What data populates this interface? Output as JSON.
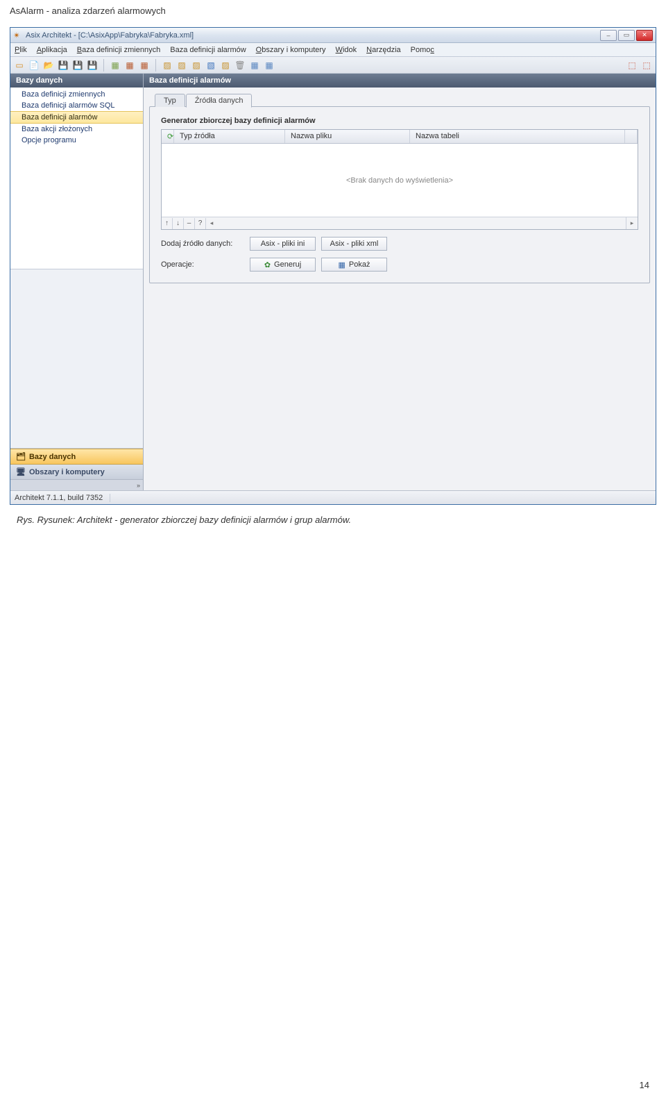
{
  "doc_header": "AsAlarm - analiza zdarzeń alarmowych",
  "title": "Asix Architekt - [C:\\AsixApp\\Fabryka\\Fabryka.xml]",
  "menu": {
    "items": [
      {
        "label": "Plik",
        "u": "P"
      },
      {
        "label": "Aplikacja",
        "u": "A"
      },
      {
        "label": "Baza definicji zmiennych",
        "u": "B"
      },
      {
        "label": "Baza definicji alarmów"
      },
      {
        "label": "Obszary i komputery",
        "u": "O"
      },
      {
        "label": "Widok",
        "u": "W"
      },
      {
        "label": "Narzędzia",
        "u": "N"
      },
      {
        "label": "Pomoc",
        "u": "c"
      }
    ]
  },
  "sidebar": {
    "header": "Bazy danych",
    "items": [
      "Baza definicji zmiennych",
      "Baza definicji alarmów SQL",
      "Baza definicji alarmów",
      "Baza akcji złożonych",
      "Opcje programu"
    ],
    "selected_index": 2,
    "tabs": {
      "active": "Bazy danych",
      "inactive": "Obszary i komputery",
      "footer_arrow": "»"
    }
  },
  "content": {
    "header": "Baza definicji alarmów",
    "tabs": {
      "typ": "Typ",
      "zrodla": "Źródła danych"
    },
    "section_title": "Generator zbiorczej bazy definicji alarmów",
    "grid": {
      "columns": [
        "Typ źródła",
        "Nazwa pliku",
        "Nazwa tabeli"
      ],
      "empty_text": "<Brak danych do wyświetlenia>",
      "footer_btns": [
        "↑",
        "↓",
        "–",
        "?"
      ]
    },
    "dodaj_label": "Dodaj źródło danych:",
    "operacje_label": "Operacje:",
    "buttons": {
      "ini": "Asix - pliki ini",
      "xml": "Asix - pliki xml",
      "generuj": "Generuj",
      "pokaz": "Pokaż"
    }
  },
  "statusbar": {
    "text": "Architekt 7.1.1, build 7352"
  },
  "caption": "Rys. Rysunek: Architekt - generator zbiorczej bazy definicji alarmów i grup alarmów.",
  "page_number": "14"
}
